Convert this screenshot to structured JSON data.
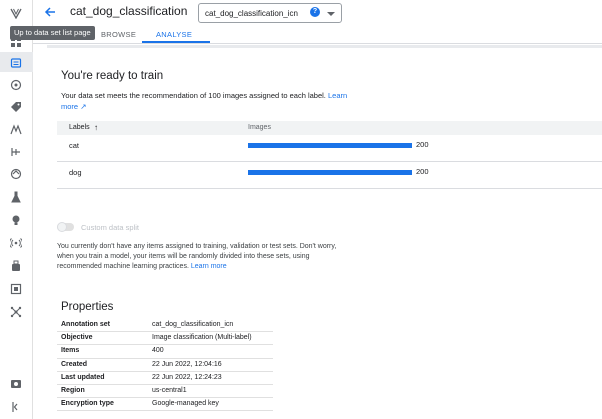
{
  "header": {
    "title": "cat_dog_classification",
    "dataset_select": "cat_dog_classification_icn",
    "back_tooltip": "Up to data set list page"
  },
  "tabs": [
    {
      "label": "BROWSE"
    },
    {
      "label": "ANALYSE"
    }
  ],
  "ready": {
    "title": "You're ready to train",
    "description": "Your data set meets the recommendation of 100 images assigned to each label. ",
    "learn_more": "Learn more"
  },
  "labels_table": {
    "headers": {
      "labels": "Labels",
      "images": "Images"
    },
    "rows": [
      {
        "label": "cat",
        "count": "200",
        "fraction": 1.0
      },
      {
        "label": "dog",
        "count": "200",
        "fraction": 1.0
      }
    ]
  },
  "split": {
    "toggle_label": "Custom data split",
    "description": "You currently don't have any items assigned to training, validation or test sets. Don't worry, when you train a model, your items will be randomly divided into these sets, using recommended machine learning practices.",
    "learn_more": "Learn more"
  },
  "properties": {
    "title": "Properties",
    "rows": [
      {
        "key": "Annotation set",
        "value": "cat_dog_classification_icn"
      },
      {
        "key": "Objective",
        "value": "Image classification (Multi-label)"
      },
      {
        "key": "Items",
        "value": "400"
      },
      {
        "key": "Created",
        "value": "22 Jun 2022, 12:04:16"
      },
      {
        "key": "Last updated",
        "value": "22 Jun 2022, 12:24:23"
      },
      {
        "key": "Region",
        "value": "us-central1"
      },
      {
        "key": "Encryption type",
        "value": "Google-managed key"
      }
    ]
  },
  "colors": {
    "accent": "#1a73e8",
    "rail_icon": "#5f6368"
  },
  "rail_icons": [
    "vertex-logo-icon",
    "dashboard-icon",
    "datasets-icon",
    "feature-store-icon",
    "labeling-icon",
    "workbench-icon",
    "pipelines-icon",
    "training-icon",
    "experiments-icon",
    "models-icon",
    "endpoints-icon",
    "batch-predictions-icon",
    "metadata-icon",
    "matching-engine-icon",
    "marketplace-icon",
    "collapse-icon"
  ]
}
